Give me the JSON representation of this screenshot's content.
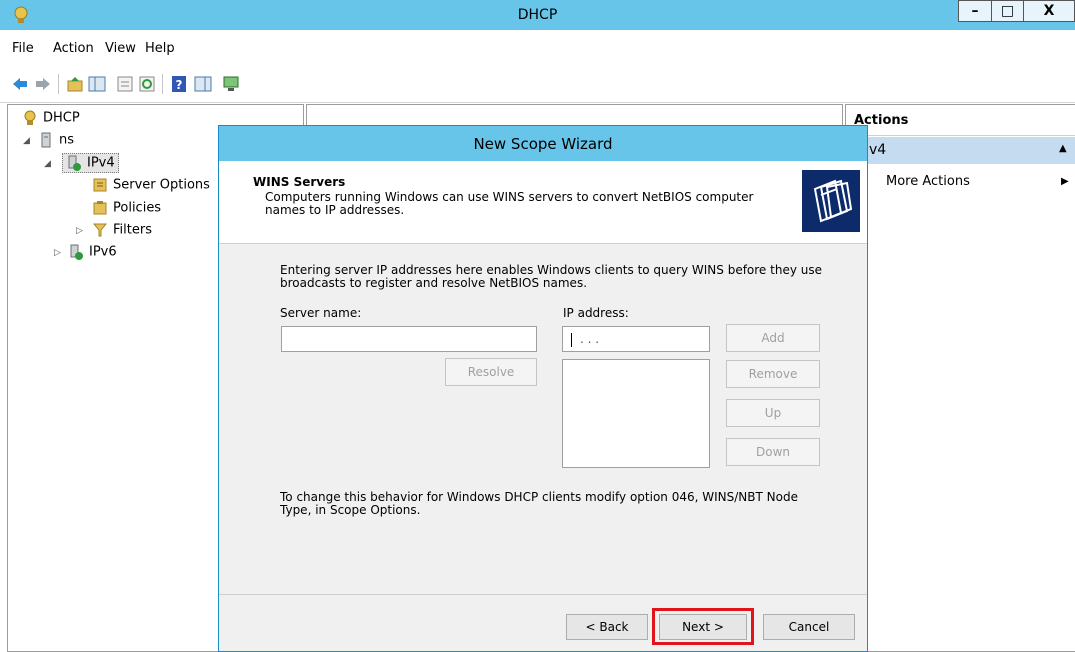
{
  "window": {
    "title": "DHCP",
    "controls": {
      "minimize": "–",
      "maximize": "□",
      "close": "X"
    }
  },
  "menu": [
    "File",
    "Action",
    "View",
    "Help"
  ],
  "toolbar_icons": [
    "back-arrow-icon",
    "forward-arrow-icon",
    "up-folder-icon",
    "show-hide-tree-icon",
    "properties-icon",
    "refresh-icon",
    "help-icon",
    "show-hide-action-pane-icon",
    "computer-icon"
  ],
  "tree": {
    "root": "DHCP",
    "server": "ns",
    "ipv4": "IPv4",
    "server_options": "Server Options",
    "policies": "Policies",
    "filters": "Filters",
    "ipv6": "IPv6"
  },
  "actions": {
    "header": "Actions",
    "selected": "v4",
    "more_actions": "More Actions"
  },
  "dialog": {
    "title": "New Scope Wizard",
    "header_title": "WINS Servers",
    "header_desc": "Computers running Windows can use WINS servers to convert NetBIOS computer names to IP addresses.",
    "intro": "Entering server IP addresses here enables Windows clients to query WINS before they use broadcasts to register and resolve NetBIOS names.",
    "server_name_label": "Server name:",
    "server_name_value": "",
    "ip_label": "IP address:",
    "ip_value": ".   .   .",
    "buttons": {
      "add": "Add",
      "resolve": "Resolve",
      "remove": "Remove",
      "up": "Up",
      "down": "Down",
      "back": "< Back",
      "next": "Next >",
      "cancel": "Cancel"
    },
    "footer_note": "To change this behavior for Windows DHCP clients modify option 046, WINS/NBT Node Type, in Scope Options."
  },
  "colors": {
    "titlebar": "#67c5ea",
    "highlight_box": "#e0141b",
    "actions_selected": "#c5dcf0"
  }
}
